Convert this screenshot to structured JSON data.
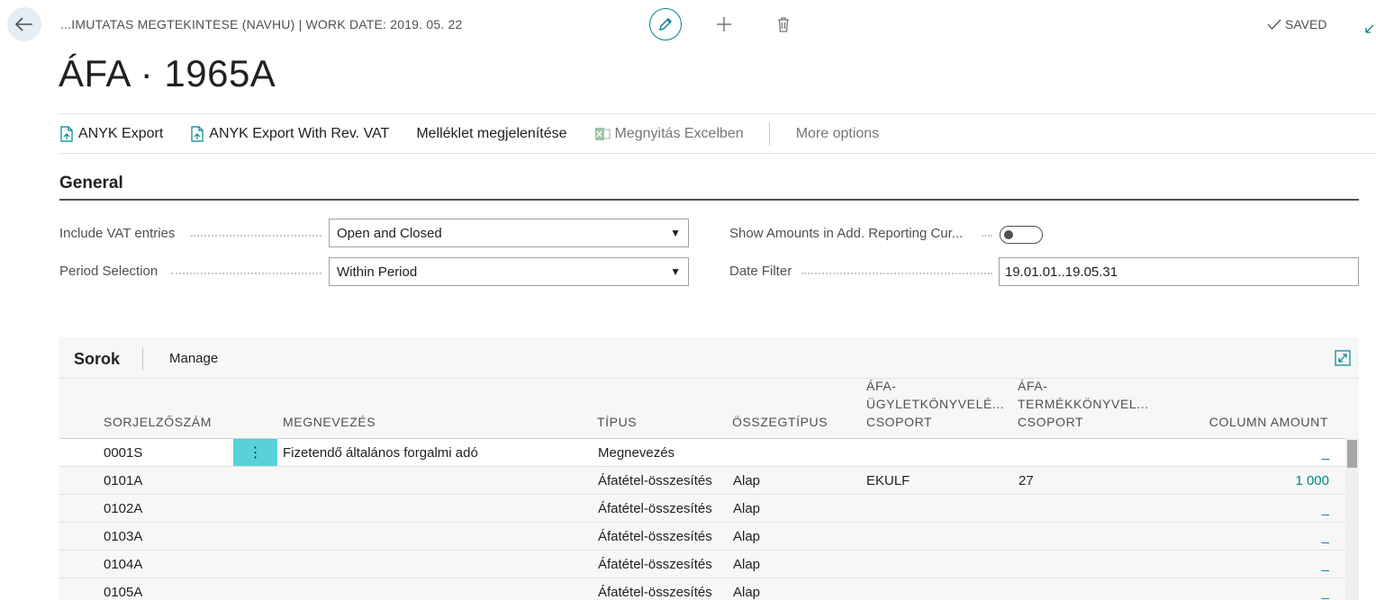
{
  "header": {
    "breadcrumb": "...IMUTATAS MEGTEKINTESE (NAVHU) | WORK DATE: 2019. 05. 22",
    "saved_label": "SAVED",
    "title": "ÁFA · 1965A"
  },
  "actions": [
    {
      "label": "ANYK Export",
      "icon": "export-doc-icon",
      "enabled": true
    },
    {
      "label": "ANYK Export With Rev. VAT",
      "icon": "export-doc-icon",
      "enabled": true
    },
    {
      "label": "Melléklet megjelenítése",
      "icon": "",
      "enabled": true
    },
    {
      "label": "Megnyitás Excelben",
      "icon": "excel-icon",
      "enabled": false
    },
    {
      "label": "More options",
      "icon": "",
      "enabled": true
    }
  ],
  "general": {
    "section_title": "General",
    "include_vat_label": "Include VAT entries",
    "include_vat_value": "Open and Closed",
    "period_label": "Period Selection",
    "period_value": "Within Period",
    "show_amounts_label": "Show Amounts in Add. Reporting Cur...",
    "show_amounts_on": false,
    "date_filter_label": "Date Filter",
    "date_filter_value": "19.01.01..19.05.31"
  },
  "lines": {
    "title": "Sorok",
    "manage_label": "Manage",
    "columns": {
      "row_no": "Sorjelzőszám",
      "description": "Megnevezés",
      "type": "Típus",
      "amount_type": "Összegtípus",
      "vat_bus_line1": "ÁFA-",
      "vat_bus_line2": "ÜGYLETKÖNYVELÉ...",
      "vat_bus_line3": "CSOPORT",
      "vat_prod_line1": "ÁFA-",
      "vat_prod_line2": "TERMÉKKÖNYVEL...",
      "vat_prod_line3": "CSOPORT",
      "column_amount": "Column Amount"
    },
    "rows": [
      {
        "row_no": "0001S",
        "description": "Fizetendő általános forgalmi adó",
        "type": "Megnevezés",
        "amount_type": "",
        "vat_bus": "",
        "vat_prod": "",
        "amount": "_"
      },
      {
        "row_no": "0101A",
        "description": "",
        "type": "Áfatétel-összesítés",
        "amount_type": "Alap",
        "vat_bus": "EKULF",
        "vat_prod": "27",
        "amount": "1 000"
      },
      {
        "row_no": "0102A",
        "description": "",
        "type": "Áfatétel-összesítés",
        "amount_type": "Alap",
        "vat_bus": "",
        "vat_prod": "",
        "amount": "_"
      },
      {
        "row_no": "0103A",
        "description": "",
        "type": "Áfatétel-összesítés",
        "amount_type": "Alap",
        "vat_bus": "",
        "vat_prod": "",
        "amount": "_"
      },
      {
        "row_no": "0104A",
        "description": "",
        "type": "Áfatétel-összesítés",
        "amount_type": "Alap",
        "vat_bus": "",
        "vat_prod": "",
        "amount": "_"
      },
      {
        "row_no": "0105A",
        "description": "",
        "type": "Áfatétel-összesítés",
        "amount_type": "Alap",
        "vat_bus": "",
        "vat_prod": "",
        "amount": "_"
      }
    ]
  },
  "colors": {
    "accent": "#00838f",
    "selected_row_menu": "#5ad0d8"
  }
}
